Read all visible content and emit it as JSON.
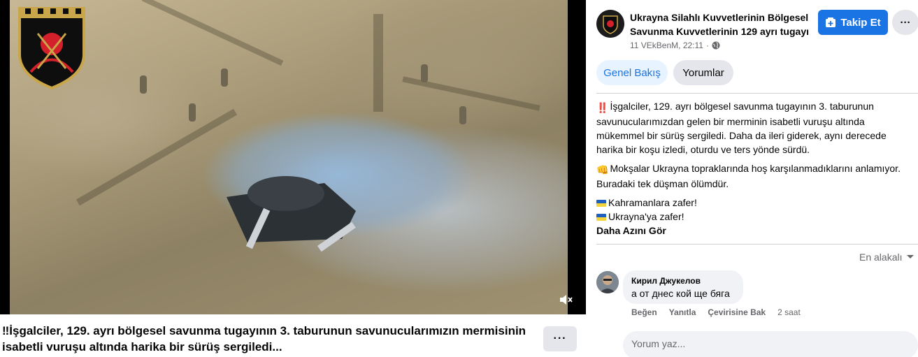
{
  "video": {
    "caption": "‼İşgalciler, 129. ayrı bölgesel savunma tugayının 3. taburunun savunucularımızın mermisinin isabetli vuruşu altında harika bir sürüş sergiledi...",
    "more_label": "···"
  },
  "page": {
    "name": "Ukrayna Silahlı Kuvvetlerinin Bölgesel Savunma Kuvvetlerinin 129 ayrı tugayı",
    "timestamp": "11 VEkBenM, 22:11",
    "separator": "·",
    "follow_label": "Takip Et",
    "more_label": "···"
  },
  "tabs": [
    {
      "label": "Genel Bakış"
    },
    {
      "label": "Yorumlar"
    }
  ],
  "post": {
    "paragraphs": [
      "İşgalciler, 129. ayrı bölgesel savunma tugayının 3. taburunun savunucularımızdan gelen bir merminin isabetli vuruşu altında mükemmel bir sürüş sergiledi. Daha da ileri giderek, aynı derecede harika bir koşu izledi, oturdu ve ters yönde sürdü.",
      "Mokşalar Ukrayna topraklarında hoş karşılanmadıklarını anlamıyor. Buradaki tek düşman ölümdür.",
      "Kahramanlara zafer!",
      "Ukrayna'ya zafer!"
    ],
    "emojis": [
      "‼️",
      "👊"
    ],
    "see_more": "Daha Azını Gör"
  },
  "comments": {
    "sort_label": "En alakalı",
    "items": [
      {
        "author": "Кирил Джукелов",
        "text": "а от днес кой ще бяга",
        "actions": [
          "Beğen",
          "Yanıtla",
          "Çevirisine Bak"
        ],
        "time": "2 saat"
      }
    ],
    "composer_placeholder": "Yorum yaz..."
  },
  "colors": {
    "accent": "#1b74e4",
    "tab_active_bg": "#e7f3ff",
    "button_bg": "#e4e6eb",
    "muted_text": "#65676b"
  },
  "icons": [
    "globe-icon",
    "plus-icon",
    "chevron-down-icon",
    "mute-icon",
    "brigade-logo"
  ]
}
